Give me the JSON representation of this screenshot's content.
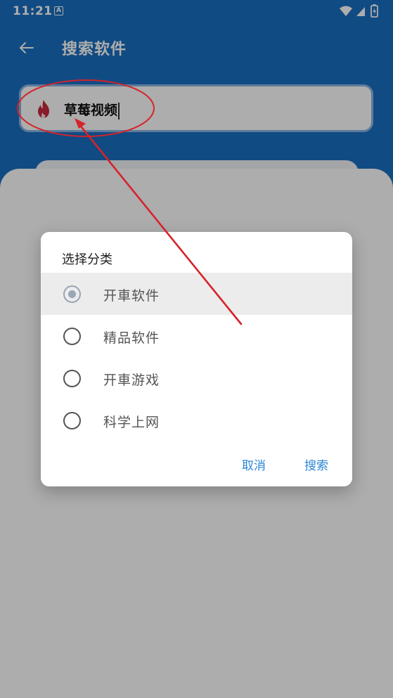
{
  "status_bar": {
    "time": "11:21",
    "notification_icon": "A",
    "icons": [
      "wifi-icon",
      "signal-icon",
      "battery-charging-icon"
    ]
  },
  "header": {
    "back_icon": "arrow-left-icon",
    "title": "搜索软件"
  },
  "search": {
    "icon": "fire-icon",
    "value": "草莓视频"
  },
  "dialog": {
    "title": "选择分类",
    "options": [
      {
        "label": "开車软件",
        "selected": true
      },
      {
        "label": "精品软件",
        "selected": false
      },
      {
        "label": "开車游戏",
        "selected": false
      },
      {
        "label": "科学上网",
        "selected": false
      }
    ],
    "cancel_label": "取消",
    "confirm_label": "搜索"
  },
  "colors": {
    "header_blue": "#1a6fc2",
    "accent": "#2a86d6",
    "annotation_red": "#d6232a",
    "fire_red": "#c8283a"
  }
}
